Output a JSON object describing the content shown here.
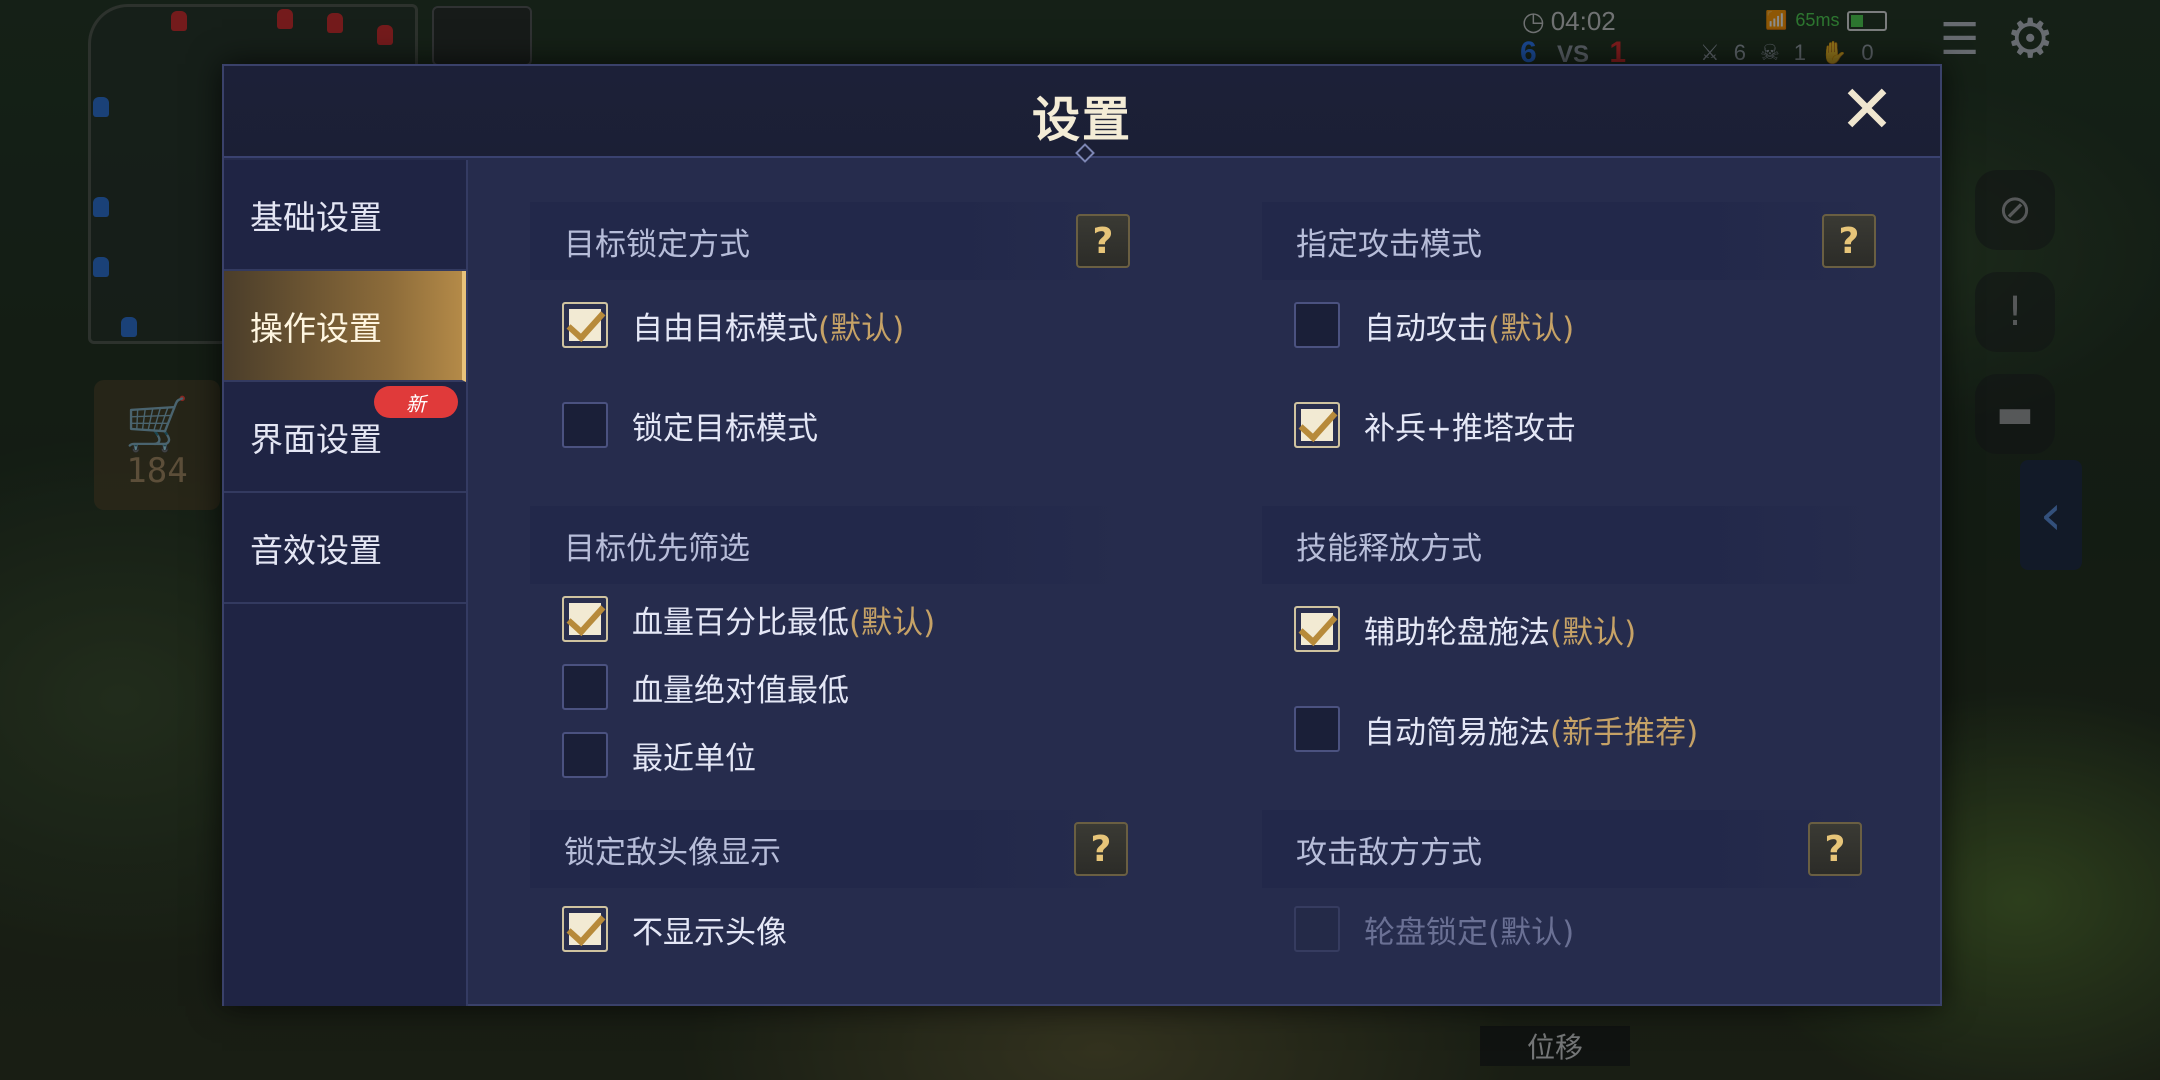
{
  "hud": {
    "time": "04:02",
    "score_blue": "6",
    "score_vs": "VS",
    "score_red": "1",
    "kills": "6",
    "deaths": "1",
    "assists": "0",
    "ping": "65ms",
    "gold": "184"
  },
  "dialog": {
    "title": "设置",
    "close": "✕"
  },
  "nav": {
    "items": [
      {
        "label": "基础设置"
      },
      {
        "label": "操作设置"
      },
      {
        "label": "界面设置",
        "badge": "新"
      },
      {
        "label": "音效设置"
      }
    ]
  },
  "sections": {
    "target_lock": {
      "title": "目标锁定方式",
      "options": [
        {
          "label": "自由目标模式",
          "tag": "(默认)",
          "checked": true
        },
        {
          "label": "锁定目标模式",
          "tag": "",
          "checked": false
        }
      ]
    },
    "attack_mode": {
      "title": "指定攻击模式",
      "options": [
        {
          "label": "自动攻击",
          "tag": "(默认)",
          "checked": false
        },
        {
          "label": "补兵+推塔攻击",
          "tag": "",
          "checked": true
        }
      ]
    },
    "target_priority": {
      "title": "目标优先筛选",
      "options": [
        {
          "label": "血量百分比最低",
          "tag": "(默认)",
          "checked": true
        },
        {
          "label": "血量绝对值最低",
          "tag": "",
          "checked": false
        },
        {
          "label": "最近单位",
          "tag": "",
          "checked": false
        }
      ]
    },
    "skill_cast": {
      "title": "技能释放方式",
      "options": [
        {
          "label": "辅助轮盘施法",
          "tag": "(默认)",
          "checked": true
        },
        {
          "label": "自动简易施法",
          "tag": "(新手推荐)",
          "checked": false
        }
      ]
    },
    "enemy_portrait": {
      "title": "锁定敌头像显示",
      "options": [
        {
          "label": "不显示头像",
          "tag": "",
          "checked": true
        }
      ]
    },
    "attack_enemy": {
      "title": "攻击敌方方式",
      "options": [
        {
          "label": "轮盘锁定(默认)",
          "tag": "",
          "checked": false,
          "disabled": true
        }
      ]
    }
  },
  "help_label": "?",
  "skill_label": "位移",
  "colors": {
    "panel": "#262c4d",
    "nav_active": "#8d6c3a",
    "accent_gold": "#c6a266",
    "badge_red": "#e03a3a"
  }
}
